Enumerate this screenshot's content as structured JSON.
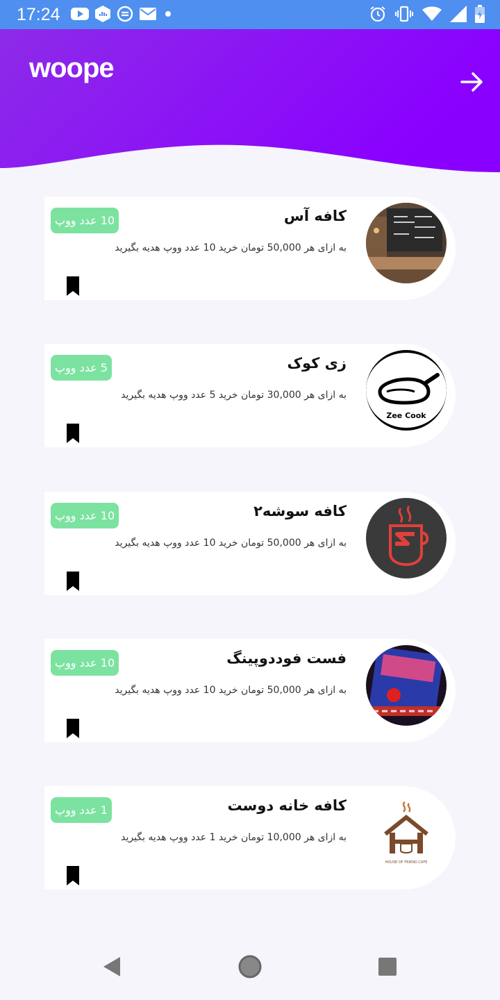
{
  "status_bar": {
    "time": "17:24",
    "left_icons": [
      "youtube-icon",
      "shield-icon",
      "sync-icon",
      "mail-icon",
      "dot-icon"
    ],
    "right_icons": [
      "alarm-icon",
      "vibrate-icon",
      "wifi-icon",
      "signal-icon",
      "battery-icon"
    ]
  },
  "header": {
    "logo_text": "woope",
    "back_icon": "arrow-right-icon",
    "gradient_start": "#8d2be8",
    "gradient_end": "#8a00ff"
  },
  "cards": [
    {
      "title": "کافه آس",
      "description": "به ازای هر 50,000 تومان خرید 10 عدد ووپ هدیه بگیرید",
      "badge": "10 عدد ووپ",
      "image": "cafe-interior-photo"
    },
    {
      "title": "زی کوک",
      "description": "به ازای هر 30,000 تومان خرید 5 عدد ووپ هدیه بگیرید",
      "badge": "5 عدد ووپ",
      "image": "zee-cook-logo",
      "logo_text": "Zee Cook"
    },
    {
      "title": "کافه سوشه۲",
      "description": "به ازای هر 50,000 تومان خرید 10 عدد ووپ هدیه بگیرید",
      "badge": "10 عدد ووپ",
      "image": "cafe-soosheh-sign"
    },
    {
      "title": "فست فوددوپینگ",
      "description": "به ازای هر 50,000 تومان خرید 10 عدد ووپ هدیه بگیرید",
      "badge": "10 عدد ووپ",
      "image": "neon-sign-photo"
    },
    {
      "title": "کافه خانه دوست",
      "description": "به ازای هر 10,000 تومان خرید 1 عدد ووپ هدیه بگیرید",
      "badge": "1 عدد ووپ",
      "image": "house-of-friend-logo",
      "logo_text": "HOUSE OF FRIEND CAFE"
    }
  ],
  "colors": {
    "badge": "#7ce2a0",
    "page_background": "#f5f5fb",
    "status_bar": "#4e8ff0"
  },
  "nav_bar": {
    "icons": [
      "back-triangle-icon",
      "home-circle-icon",
      "recents-square-icon"
    ]
  }
}
